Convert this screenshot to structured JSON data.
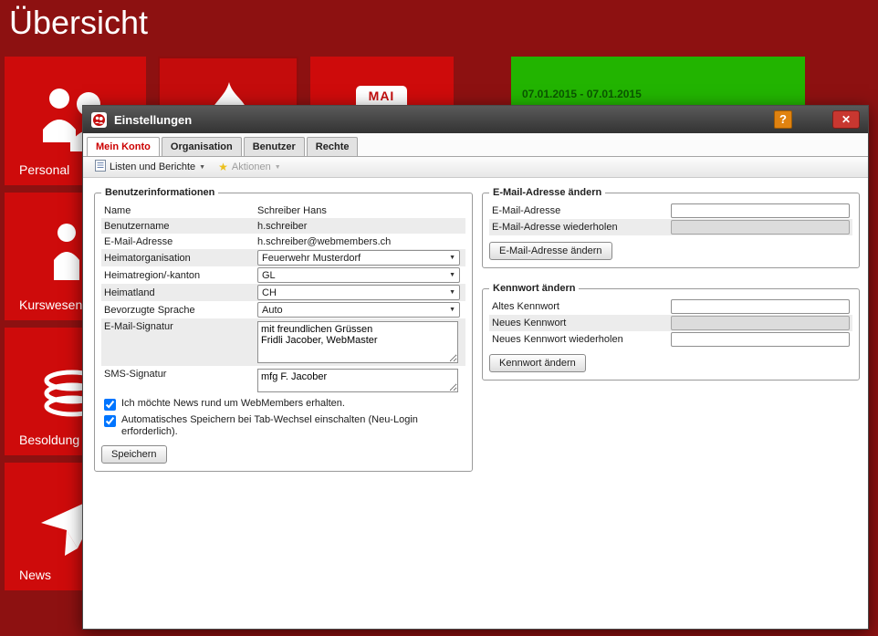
{
  "page": {
    "title": "Übersicht"
  },
  "colors": {
    "background": "#8d1111",
    "tile_red": "#ce0b0b",
    "tile_green": "#22b400",
    "accent_red": "#cc0000",
    "titlebar_gray": "#3c3c3c",
    "help_orange": "#e0820f"
  },
  "icons": {
    "caret_down": "▼",
    "star": "★"
  },
  "tiles": {
    "personal": {
      "label": "Personal"
    },
    "kurswesen": {
      "label": "Kurswesen"
    },
    "besoldung": {
      "label": "Besoldung"
    },
    "news": {
      "label": "News"
    },
    "calendar": {
      "month": "MAI"
    },
    "date_tile": {
      "label": "07.01.2015 - 07.01.2015"
    }
  },
  "dialog": {
    "title": "Einstellungen",
    "help": "?",
    "close": "✕",
    "tabs": [
      {
        "label": "Mein Konto"
      },
      {
        "label": "Organisation"
      },
      {
        "label": "Benutzer"
      },
      {
        "label": "Rechte"
      }
    ],
    "toolbar": {
      "lists_label": "Listen und Berichte",
      "actions_label": "Aktionen"
    },
    "account": {
      "legend": "Benutzerinformationen",
      "rows": [
        {
          "label": "Name",
          "value": "Schreiber Hans"
        },
        {
          "label": "Benutzername",
          "value": "h.schreiber"
        },
        {
          "label": "E-Mail-Adresse",
          "value": "h.schreiber@webmembers.ch"
        },
        {
          "label": "Heimatorganisation",
          "value": "Feuerwehr Musterdorf"
        },
        {
          "label": "Heimatregion/-kanton",
          "value": "GL"
        },
        {
          "label": "Heimatland",
          "value": "CH"
        },
        {
          "label": "Bevorzugte Sprache",
          "value": "Auto"
        },
        {
          "label": "E-Mail-Signatur",
          "value": "mit freundlichen Grüssen\nFridli Jacober, WebMaster"
        },
        {
          "label": "SMS-Signatur",
          "value": "mfg F. Jacober"
        }
      ],
      "checkbox_news": "Ich möchte News rund um WebMembers erhalten.",
      "checkbox_autosave": "Automatisches Speichern bei Tab-Wechsel einschalten (Neu-Login erforderlich).",
      "save_button": "Speichern"
    },
    "change_email": {
      "legend": "E-Mail-Adresse ändern",
      "email_label": "E-Mail-Adresse",
      "email_repeat_label": "E-Mail-Adresse wiederholen",
      "button": "E-Mail-Adresse ändern"
    },
    "change_password": {
      "legend": "Kennwort ändern",
      "old_label": "Altes Kennwort",
      "new_label": "Neues Kennwort",
      "new_repeat_label": "Neues Kennwort wiederholen",
      "button": "Kennwort ändern"
    }
  }
}
